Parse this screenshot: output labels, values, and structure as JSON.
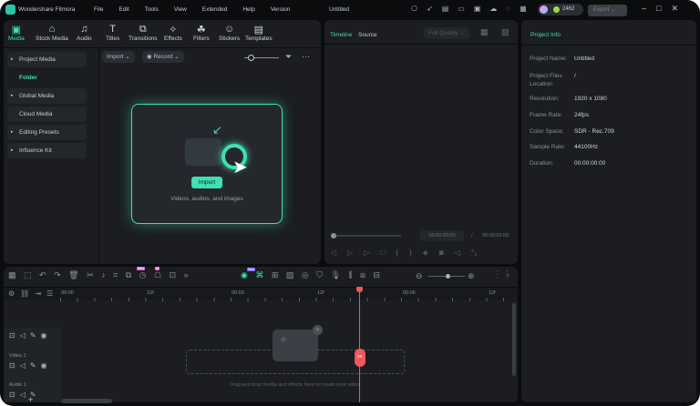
{
  "app": {
    "name": "Wondershare Filmora",
    "title": "Untitled",
    "credits": "2462",
    "export": "Export"
  },
  "menu": [
    "File",
    "Edit",
    "Tools",
    "View",
    "Extended",
    "Help",
    "Version"
  ],
  "tabs": [
    {
      "label": "Media",
      "icon": "▣"
    },
    {
      "label": "Stock Media",
      "icon": "⌂"
    },
    {
      "label": "Audio",
      "icon": "♫"
    },
    {
      "label": "Titles",
      "icon": "T"
    },
    {
      "label": "Transitions",
      "icon": "⧉"
    },
    {
      "label": "Effects",
      "icon": "✧"
    },
    {
      "label": "Filters",
      "icon": "☘"
    },
    {
      "label": "Stickers",
      "icon": "☺"
    },
    {
      "label": "Templates",
      "icon": "▤"
    }
  ],
  "sidebar": {
    "project_media": "Project Media",
    "folder": "Folder",
    "global_media": "Global Media",
    "cloud_media": "Cloud Media",
    "editing_presets": "Editing Presets",
    "influence_kit": "Influence Kit"
  },
  "media": {
    "import": "Import",
    "record": "Record",
    "import_button": "Import",
    "hint": "Videos, audios, and images"
  },
  "preview": {
    "timeline": "Timeline",
    "source": "Source",
    "quality": "Full Quality",
    "current_time": "00:00:00:00",
    "separator": "/",
    "total_time": "00:00:00:00"
  },
  "project_info": {
    "title": "Project Info",
    "rows": [
      [
        "Project Name:",
        "Untitled"
      ],
      [
        "Project Files Location:",
        "/"
      ],
      [
        "Resolution:",
        "1920 x 1080"
      ],
      [
        "Frame Rate:",
        "24fps"
      ],
      [
        "Color Space:",
        "SDR - Rec.709"
      ],
      [
        "Sample Rate:",
        "44100Hz"
      ],
      [
        "Duration:",
        "00:00:00:00"
      ]
    ]
  },
  "timeline": {
    "ruler": [
      "00:00",
      "12f",
      "00:03",
      "12f",
      "00:06",
      "12f"
    ],
    "video_track": "Video 1",
    "audio_track": "Audio 1",
    "drop_hint": "Drag and drop media and effects here to create your video.",
    "badges": [
      "New",
      "AI",
      "New"
    ]
  },
  "colors": {
    "accent": "#3ee0b4",
    "playhead": "#f2575b"
  }
}
